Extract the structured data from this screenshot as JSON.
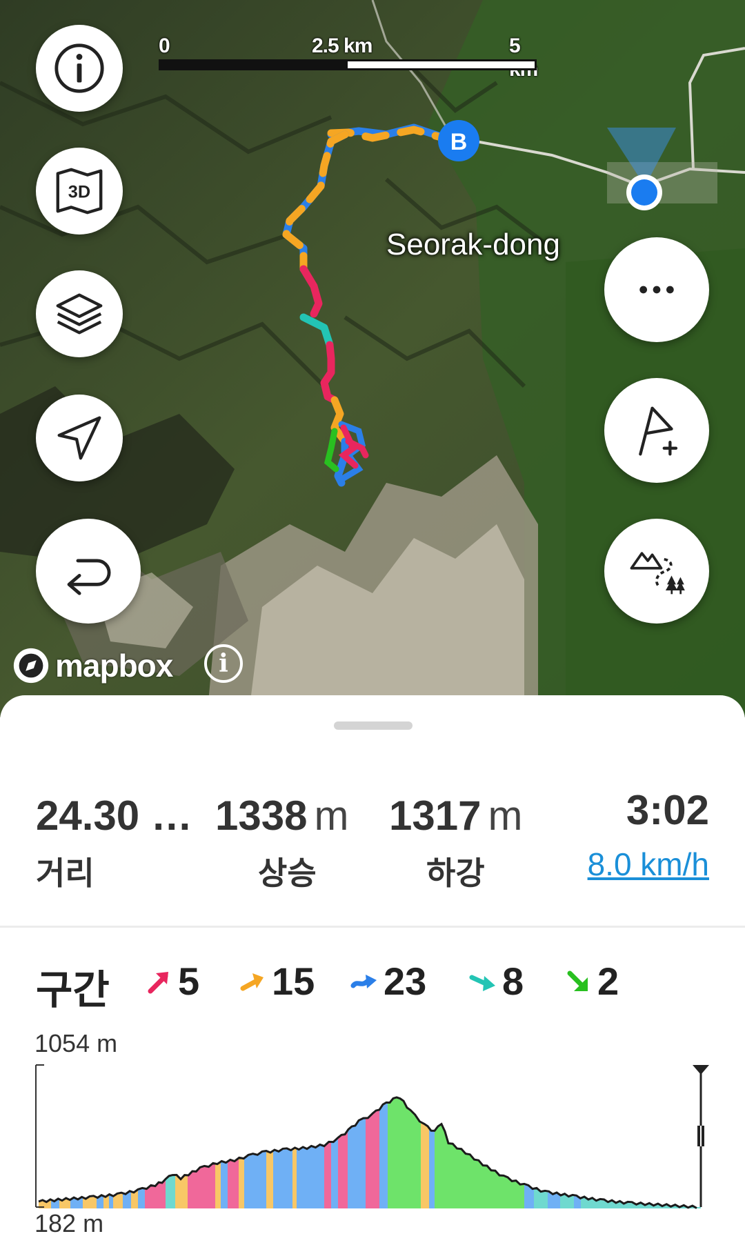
{
  "map": {
    "scale": {
      "labels": [
        "0",
        "2.5 km",
        "5 km"
      ]
    },
    "place_name": "Seorak-dong",
    "route_end_marker": "B",
    "attribution": {
      "logo_text": "mapbox",
      "info_icon": "info-icon"
    },
    "left_buttons": [
      {
        "name": "info-button",
        "icon": "info-icon"
      },
      {
        "name": "3d-map-button",
        "icon": "3d-map-icon"
      },
      {
        "name": "layers-button",
        "icon": "layers-icon"
      },
      {
        "name": "locate-button",
        "icon": "navigation-arrow-icon"
      },
      {
        "name": "reverse-route-button",
        "icon": "return-arrow-icon"
      }
    ],
    "right_buttons": [
      {
        "name": "more-options-button",
        "icon": "more-dots-icon"
      },
      {
        "name": "add-waypoint-button",
        "icon": "flag-plus-icon"
      },
      {
        "name": "trail-poi-button",
        "icon": "mountain-trail-icon"
      }
    ]
  },
  "summary": {
    "distance": {
      "value": "24.30 …",
      "label": "거리"
    },
    "ascent": {
      "value": "1338",
      "unit": "m",
      "label": "상승"
    },
    "descent": {
      "value": "1317",
      "unit": "m",
      "label": "하강"
    },
    "duration": {
      "value": "3:02",
      "speed": "8.0 km/h"
    }
  },
  "segments": {
    "title": "구간",
    "items": [
      {
        "icon": "steep-up-arrow-icon",
        "color": "#e8265e",
        "count": "5"
      },
      {
        "icon": "up-arrow-icon",
        "color": "#f5a623",
        "count": "15"
      },
      {
        "icon": "flat-arrow-icon",
        "color": "#2b7fe8",
        "count": "23"
      },
      {
        "icon": "down-arrow-icon",
        "color": "#23c4b4",
        "count": "8"
      },
      {
        "icon": "steep-down-arrow-icon",
        "color": "#29c020",
        "count": "2"
      }
    ]
  },
  "elevation": {
    "max_label": "1054 m",
    "min_label": "182 m"
  },
  "colors": {
    "steep_up": "#f0689a",
    "up": "#f8c766",
    "flat": "#6fb0f5",
    "down": "#6fd9cf",
    "steep_down": "#6ee36a",
    "link": "#1a8fd8",
    "location": "#1a7cf0"
  }
}
